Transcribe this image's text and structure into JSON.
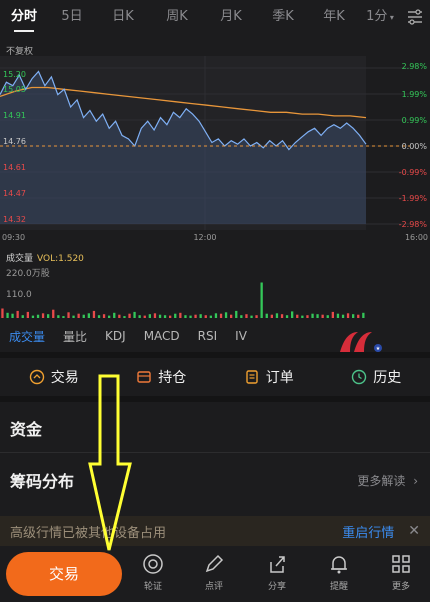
{
  "tabs": [
    {
      "label": "分时"
    },
    {
      "label": "5日"
    },
    {
      "label": "日K"
    },
    {
      "label": "周K"
    },
    {
      "label": "月K"
    },
    {
      "label": "季K"
    },
    {
      "label": "年K"
    },
    {
      "label": "1分"
    }
  ],
  "adjust_label": "不复权",
  "chart_data": {
    "type": "line",
    "price_ticks_left": [
      "15.20",
      "15.05",
      "14.91",
      "14.76",
      "14.61",
      "14.47",
      "14.32"
    ],
    "pct_ticks_right": [
      "2.98%",
      "1.99%",
      "0.99%",
      "0.00%",
      "-0.99%",
      "-1.99%",
      "-2.98%"
    ],
    "time_ticks": [
      "09:30",
      "12:00",
      "16:00"
    ],
    "ylim": [
      14.32,
      15.2
    ],
    "prev_close": 14.76,
    "price_series": [
      15.05,
      15.12,
      15.1,
      15.16,
      15.08,
      15.14,
      15.18,
      15.1,
      15.15,
      15.05,
      15.08,
      14.98,
      15.02,
      14.92,
      14.96,
      14.9,
      14.94,
      14.86,
      14.9,
      14.82,
      14.8,
      14.76,
      14.86,
      14.9,
      14.85,
      14.92,
      14.88,
      14.95,
      14.92,
      14.97,
      14.94,
      14.9,
      14.84,
      14.78,
      14.8,
      14.76,
      14.79,
      14.77,
      14.8,
      14.76,
      14.78,
      14.75,
      14.79,
      14.76,
      14.79,
      14.74,
      14.78,
      14.81,
      14.84,
      14.86,
      14.82,
      14.86,
      14.88,
      14.86,
      14.89,
      14.86,
      14.82,
      14.77
    ],
    "avg_series": [
      15.04,
      15.07,
      15.09,
      15.09,
      15.08,
      15.07,
      15.06,
      15.05,
      15.04,
      15.03,
      15.02,
      15.01,
      15.0,
      14.99,
      14.98,
      14.97,
      14.96,
      14.95,
      14.95,
      14.94,
      14.94,
      14.93,
      14.93,
      14.92
    ],
    "volume_label": "成交量",
    "volume_value": "VOL:1.520",
    "volume_ticks": [
      "220.0万股",
      "110.0"
    ],
    "volume_ylim": [
      0,
      220
    ],
    "volume_values": [
      40,
      22,
      18,
      30,
      12,
      26,
      10,
      14,
      20,
      16,
      35,
      12,
      8,
      24,
      10,
      18,
      14,
      20,
      30,
      12,
      16,
      10,
      22,
      14,
      8,
      18,
      26,
      12,
      10,
      16,
      20,
      14,
      12,
      10,
      18,
      22,
      12,
      10,
      14,
      16,
      12,
      10,
      20,
      18,
      24,
      14,
      30,
      12,
      16,
      10,
      12,
      150,
      18,
      14,
      20,
      16,
      12,
      28,
      14,
      10,
      12,
      18,
      16,
      14,
      12,
      26,
      18,
      14,
      20,
      16,
      14,
      22
    ]
  },
  "indicators": [
    {
      "label": "成交量",
      "active": true
    },
    {
      "label": "量比"
    },
    {
      "label": "KDJ"
    },
    {
      "label": "MACD"
    },
    {
      "label": "RSI"
    },
    {
      "label": "IV"
    }
  ],
  "actions": [
    {
      "label": "交易",
      "icon": "trade-icon"
    },
    {
      "label": "持仓",
      "icon": "position-icon"
    },
    {
      "label": "订单",
      "icon": "order-icon"
    },
    {
      "label": "历史",
      "icon": "history-icon"
    }
  ],
  "sections": {
    "funds": "资金",
    "chip": "筹码分布",
    "chip_more": "更多解读"
  },
  "banner": {
    "message": "高级行情已被其他设备占用",
    "action": "重启行情",
    "close": "✕"
  },
  "bottom": {
    "trade": "交易",
    "items": [
      {
        "label": "轮证",
        "icon": "warrant-icon"
      },
      {
        "label": "点评",
        "icon": "pen-icon"
      },
      {
        "label": "分享",
        "icon": "share-icon"
      },
      {
        "label": "提醒",
        "icon": "bell-icon"
      },
      {
        "label": "更多",
        "icon": "grid-icon"
      }
    ]
  },
  "colors": {
    "accent": "#f26a1b",
    "price_line": "#7fb0f5",
    "avg_line": "#e8963a",
    "up": "#34c759",
    "down": "#e84a4a",
    "link": "#3b8cf0",
    "annotation_arrow": "#ffff33"
  }
}
